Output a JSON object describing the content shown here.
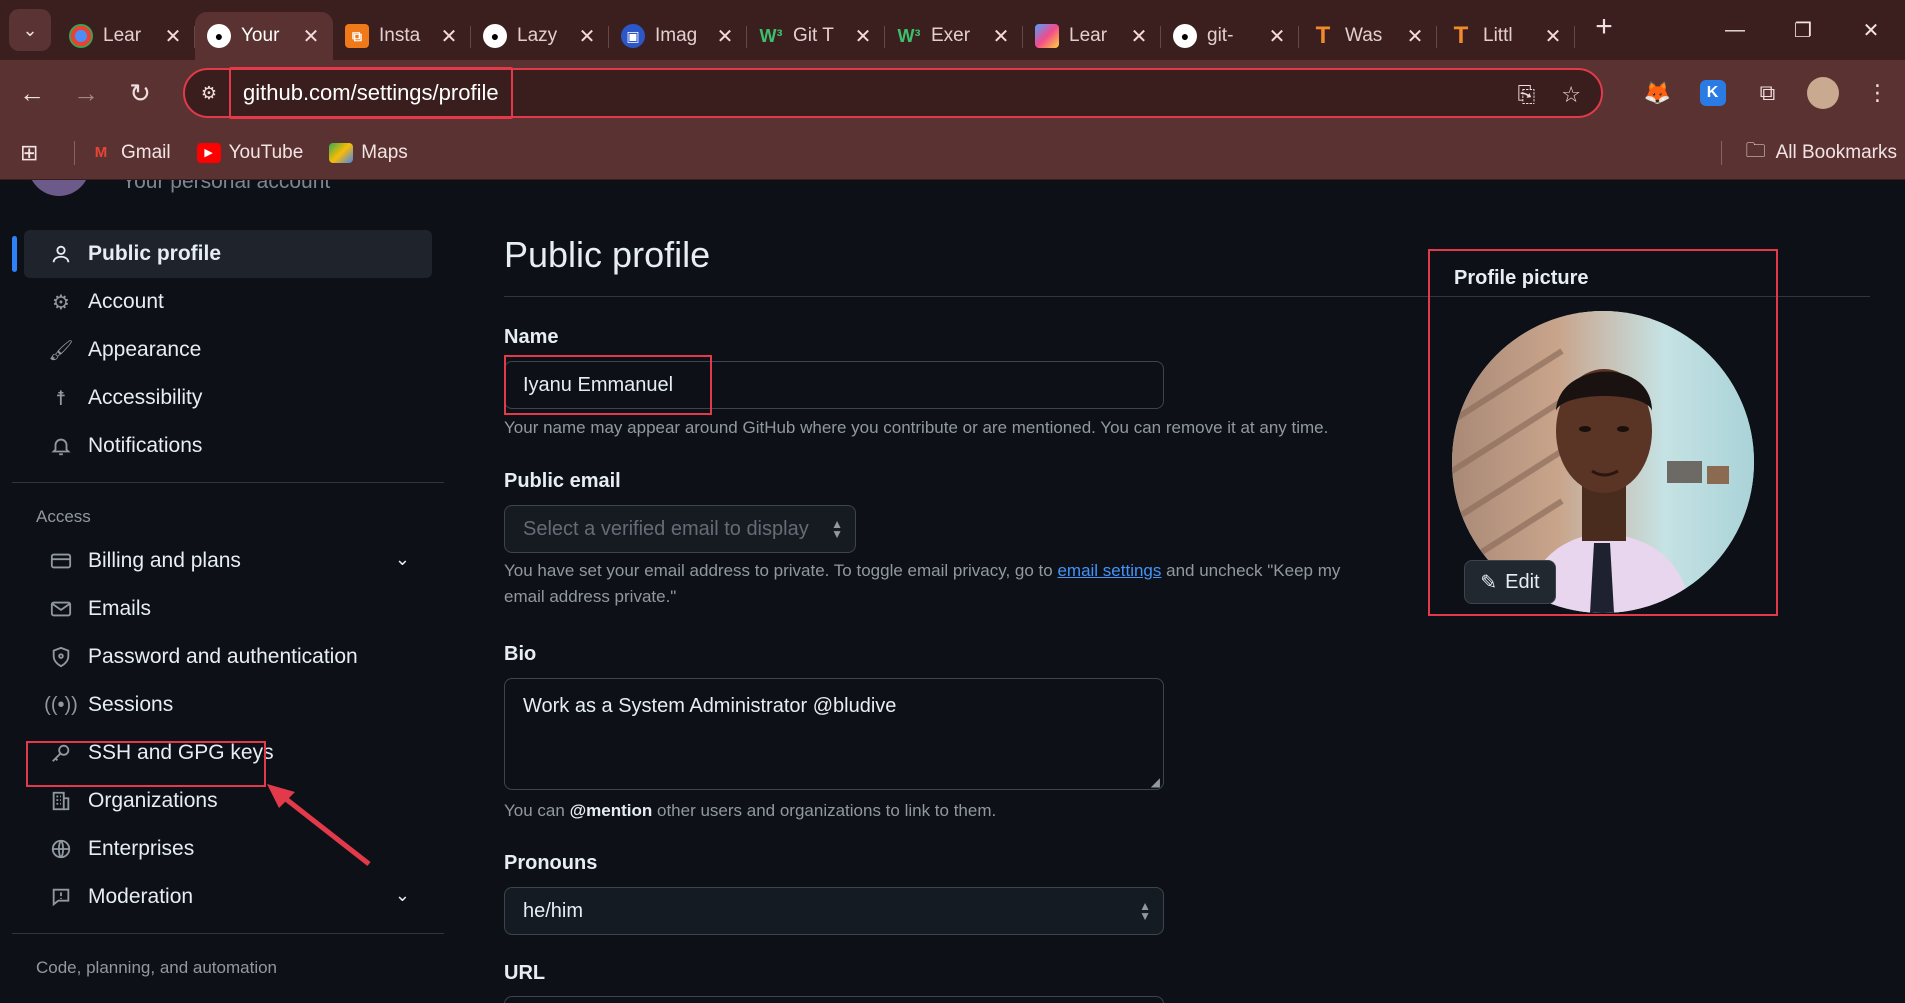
{
  "browser": {
    "tabs": [
      {
        "title": "Lear",
        "icon": "chrome-logo-icon",
        "active": false
      },
      {
        "title": "Your",
        "icon": "github-icon",
        "active": true
      },
      {
        "title": "Insta",
        "icon": "orange-squares-icon",
        "active": false
      },
      {
        "title": "Lazy",
        "icon": "github-icon",
        "active": false
      },
      {
        "title": "Imag",
        "icon": "blue-circle-icon",
        "active": false
      },
      {
        "title": "Git T",
        "icon": "w3schools-icon",
        "active": false
      },
      {
        "title": "Exer",
        "icon": "w3schools-icon",
        "active": false
      },
      {
        "title": "Lear",
        "icon": "colorful-square-icon",
        "active": false
      },
      {
        "title": "git-",
        "icon": "github-icon",
        "active": false
      },
      {
        "title": "Was",
        "icon": "t-logo-icon",
        "active": false
      },
      {
        "title": "Littl",
        "icon": "t-logo-icon",
        "active": false
      }
    ],
    "url": "github.com/settings/profile",
    "bookmarks": [
      {
        "label": "Gmail",
        "icon": "gmail-icon"
      },
      {
        "label": "YouTube",
        "icon": "youtube-icon"
      },
      {
        "label": "Maps",
        "icon": "maps-icon"
      }
    ],
    "all_bookmarks": "All Bookmarks"
  },
  "header": {
    "subtitle": "Your personal account"
  },
  "sidebar": {
    "items": [
      {
        "label": "Public profile",
        "icon": "person-icon"
      },
      {
        "label": "Account",
        "icon": "gear-icon"
      },
      {
        "label": "Appearance",
        "icon": "paintbrush-icon"
      },
      {
        "label": "Accessibility",
        "icon": "accessibility-icon"
      },
      {
        "label": "Notifications",
        "icon": "bell-icon"
      }
    ],
    "access_label": "Access",
    "access_items": [
      {
        "label": "Billing and plans",
        "icon": "credit-card-icon"
      },
      {
        "label": "Emails",
        "icon": "mail-icon"
      },
      {
        "label": "Password and authentication",
        "icon": "shield-icon"
      },
      {
        "label": "Sessions",
        "icon": "broadcast-icon"
      },
      {
        "label": "SSH and GPG keys",
        "icon": "key-icon"
      },
      {
        "label": "Organizations",
        "icon": "organization-icon"
      },
      {
        "label": "Enterprises",
        "icon": "globe-icon"
      },
      {
        "label": "Moderation",
        "icon": "report-icon"
      }
    ],
    "code_label": "Code, planning, and automation"
  },
  "main": {
    "title": "Public profile",
    "name_label": "Name",
    "name_value": "Iyanu Emmanuel",
    "name_note": "Your name may appear around GitHub where you contribute or are mentioned. You can remove it at any time.",
    "email_label": "Public email",
    "email_placeholder": "Select a verified email to display",
    "email_note_1": "You have set your email address to private. To toggle email privacy, go to",
    "email_note_link": "email settings",
    "email_note_2": "and uncheck \"Keep my",
    "email_note_3": "email address private.\"",
    "bio_label": "Bio",
    "bio_value": "Work as a System Administrator @bludive",
    "bio_note_1": "You can",
    "bio_note_mention": "@mention",
    "bio_note_2": "other users and organizations to link to them.",
    "pronouns_label": "Pronouns",
    "pronouns_value": "he/him",
    "url_label": "URL",
    "profile_picture_label": "Profile picture",
    "edit_label": "Edit"
  },
  "colors": {
    "accent": "#2f81f7",
    "annotation": "#e23a4a",
    "chrome": "#5a3232"
  }
}
